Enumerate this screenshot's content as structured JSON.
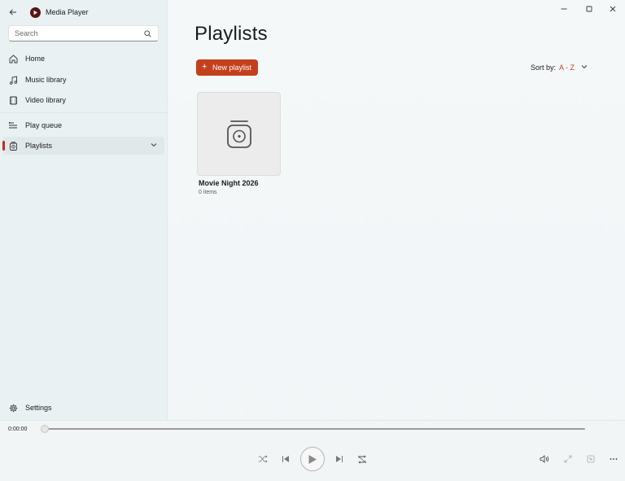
{
  "app": {
    "title": "Media Player"
  },
  "search": {
    "placeholder": "Search"
  },
  "sidebar": {
    "items": [
      {
        "label": "Home",
        "icon": "home-icon"
      },
      {
        "label": "Music library",
        "icon": "music-note-icon"
      },
      {
        "label": "Video library",
        "icon": "video-icon"
      },
      {
        "label": "Play queue",
        "icon": "play-queue-icon"
      },
      {
        "label": "Playlists",
        "icon": "playlist-icon",
        "active": true
      }
    ],
    "settings_label": "Settings"
  },
  "main": {
    "title": "Playlists",
    "new_playlist_label": "New playlist",
    "sort": {
      "label": "Sort by:",
      "value": "A - Z"
    },
    "playlists": [
      {
        "name": "Movie Night 2026",
        "count": "0 items"
      }
    ]
  },
  "player": {
    "time": "0:00:00",
    "progress": 0
  },
  "colors": {
    "accent": "#c4401c",
    "active_indicator": "#c42b1c"
  }
}
